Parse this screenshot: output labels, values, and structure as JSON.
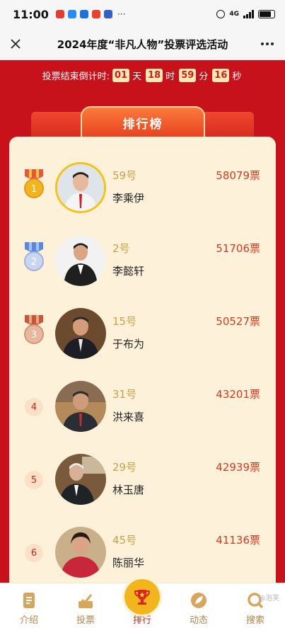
{
  "status": {
    "time": "11:00",
    "network": "4G",
    "more": "···"
  },
  "header": {
    "title": "2024年度“非凡人物”投票评选活动"
  },
  "countdown": {
    "label": "投票结束倒计时:",
    "days": "01",
    "days_unit": "天",
    "hours": "18",
    "hours_unit": "时",
    "minutes": "59",
    "minutes_unit": "分",
    "seconds": "16",
    "seconds_unit": "秒"
  },
  "ranking": {
    "tab_label": "排行榜",
    "rows": [
      {
        "rank": "1",
        "number": "59号",
        "name": "李乘伊",
        "votes": "58079票",
        "medal": "gold"
      },
      {
        "rank": "2",
        "number": "2号",
        "name": "李懿轩",
        "votes": "51706票",
        "medal": "silver"
      },
      {
        "rank": "3",
        "number": "15号",
        "name": "于布为",
        "votes": "50527票",
        "medal": "bronze"
      },
      {
        "rank": "4",
        "number": "31号",
        "name": "洪来喜",
        "votes": "43201票",
        "medal": "none"
      },
      {
        "rank": "5",
        "number": "29号",
        "name": "林玉唐",
        "votes": "42939票",
        "medal": "none"
      },
      {
        "rank": "6",
        "number": "45号",
        "name": "陈丽华",
        "votes": "41136票",
        "medal": "none"
      }
    ]
  },
  "nav": {
    "items": [
      {
        "label": "介绍",
        "icon": "document-icon"
      },
      {
        "label": "投票",
        "icon": "vote-icon"
      },
      {
        "label": "排行",
        "icon": "trophy-icon"
      },
      {
        "label": "动态",
        "icon": "leaf-icon"
      },
      {
        "label": "搜索",
        "icon": "search-icon"
      }
    ],
    "watermark": "@泡芙"
  },
  "colors": {
    "accent": "#c8121b",
    "panel": "#fdf1d9",
    "gold": "#f2c21d",
    "votes": "#d43a20"
  }
}
